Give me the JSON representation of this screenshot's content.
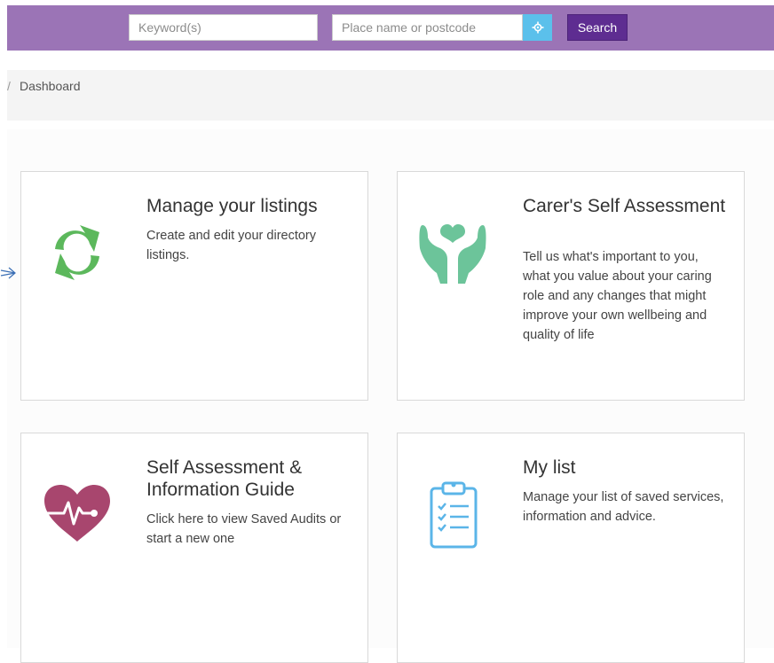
{
  "header": {
    "keyword_placeholder": "Keyword(s)",
    "place_placeholder": "Place name or postcode",
    "search_label": "Search"
  },
  "breadcrumb": {
    "separator": "/",
    "current": "Dashboard"
  },
  "cards": [
    {
      "title": "Manage your listings",
      "description": "Create and edit your directory listings.",
      "icon": "refresh-arrows-icon",
      "icon_color": "#5cb85c"
    },
    {
      "title": "Carer's Self Assessment",
      "description": "Tell us what's important to you, what you value about your caring role and any changes that might improve your own wellbeing and quality of life",
      "icon": "hands-heart-icon",
      "icon_color": "#6cc49a"
    },
    {
      "title": "Self Assessment & Information Guide",
      "description": "Click here to view Saved Audits or start a new one",
      "icon": "heart-pulse-icon",
      "icon_color": "#a8466e"
    },
    {
      "title": "My list",
      "description": "Manage your list of saved services, information and advice.",
      "icon": "clipboard-checklist-icon",
      "icon_color": "#5bb5e8"
    }
  ],
  "colors": {
    "header_bg": "#9b74b6",
    "search_button": "#5e2d91",
    "locate_button": "#5bc0eb"
  }
}
